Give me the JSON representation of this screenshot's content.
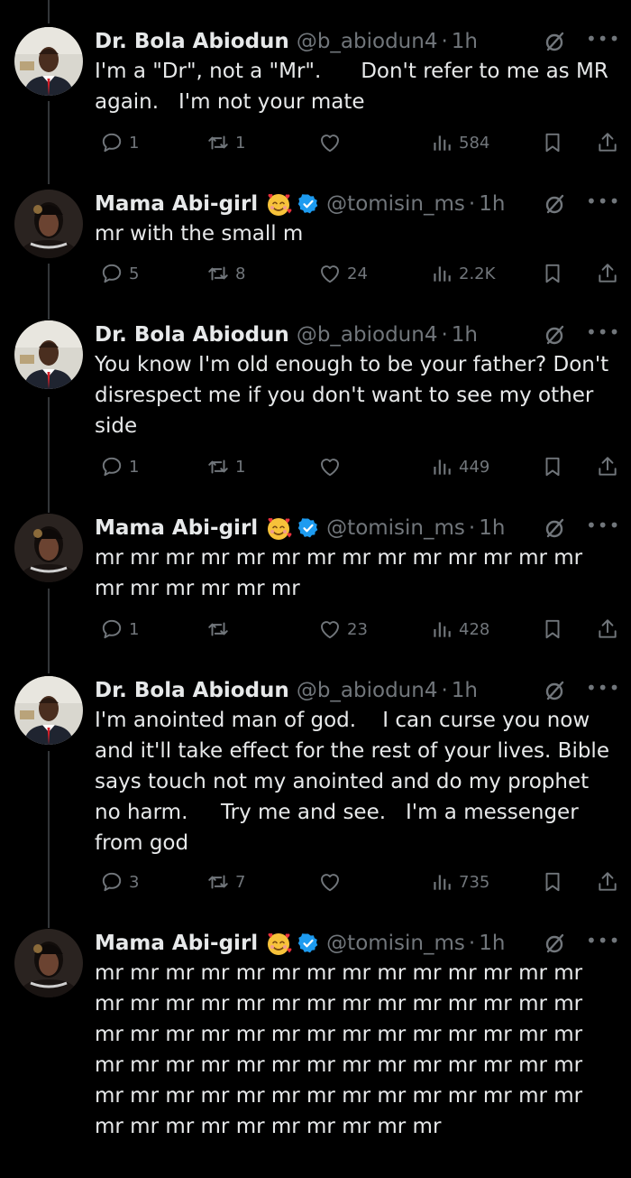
{
  "tweets": [
    {
      "author": "Dr. Bola Abiodun",
      "handle": "@b_abiodun4",
      "time": "1h",
      "avatar": "man",
      "text": "I'm a \"Dr\", not a \"Mr\".      Don't refer to me as MR again.   I'm not your mate",
      "replies": "1",
      "reposts": "1",
      "likes": "",
      "views": "584"
    },
    {
      "author": "Mama Abi-girl",
      "handle": "@tomisin_ms",
      "time": "1h",
      "avatar": "woman",
      "emoji": "smiling-face-with-hearts",
      "verified": true,
      "text": "mr with the small m",
      "replies": "5",
      "reposts": "8",
      "likes": "24",
      "views": "2.2K"
    },
    {
      "author": "Dr. Bola Abiodun",
      "handle": "@b_abiodun4",
      "time": "1h",
      "avatar": "man",
      "text": "You know I'm old enough to be your father? Don't disrespect me if you don't want to see my other side",
      "replies": "1",
      "reposts": "1",
      "likes": "",
      "views": "449"
    },
    {
      "author": "Mama Abi-girl",
      "handle": "@tomisin_ms",
      "time": "1h",
      "avatar": "woman",
      "emoji": "smiling-face-with-hearts",
      "verified": true,
      "text": "mr mr mr mr mr mr mr mr mr mr mr mr mr mr mr mr mr mr mr mr",
      "replies": "1",
      "reposts": "",
      "likes": "23",
      "views": "428"
    },
    {
      "author": "Dr. Bola Abiodun",
      "handle": "@b_abiodun4",
      "time": "1h",
      "avatar": "man",
      "text": "I'm anointed man of god.    I can curse you now and it'll take effect for the rest of your lives. Bible says touch not my anointed and do my prophet no harm.     Try me and see.   I'm a messenger from god",
      "replies": "3",
      "reposts": "7",
      "likes": "",
      "views": "735"
    },
    {
      "author": "Mama Abi-girl",
      "handle": "@tomisin_ms",
      "time": "1h",
      "avatar": "woman",
      "emoji": "smiling-face-with-hearts",
      "verified": true,
      "text": "mr mr mr mr mr mr mr mr mr mr mr mr mr mr mr mr mr mr mr mr mr mr mr mr mr mr mr mr mr mr mr mr mr mr mr mr mr mr mr mr mr mr mr mr mr mr mr mr mr mr mr mr mr mr mr mr mr mr mr mr mr mr mr mr mr mr mr mr mr mr mr mr mr mr mr mr mr mr mr mr",
      "replies": null,
      "reposts": null,
      "likes": null,
      "views": null
    }
  ],
  "icons": {
    "reply": "reply-icon",
    "repost": "repost-icon",
    "like": "heart-icon",
    "views": "views-icon",
    "bookmark": "bookmark-icon",
    "share": "share-icon",
    "grok": "grok-icon",
    "more": "more-icon"
  },
  "colors": {
    "background": "#000000",
    "text": "#e7e9ea",
    "secondary": "#71767b",
    "verified": "#1d9bf0",
    "thread_line": "#333639"
  }
}
